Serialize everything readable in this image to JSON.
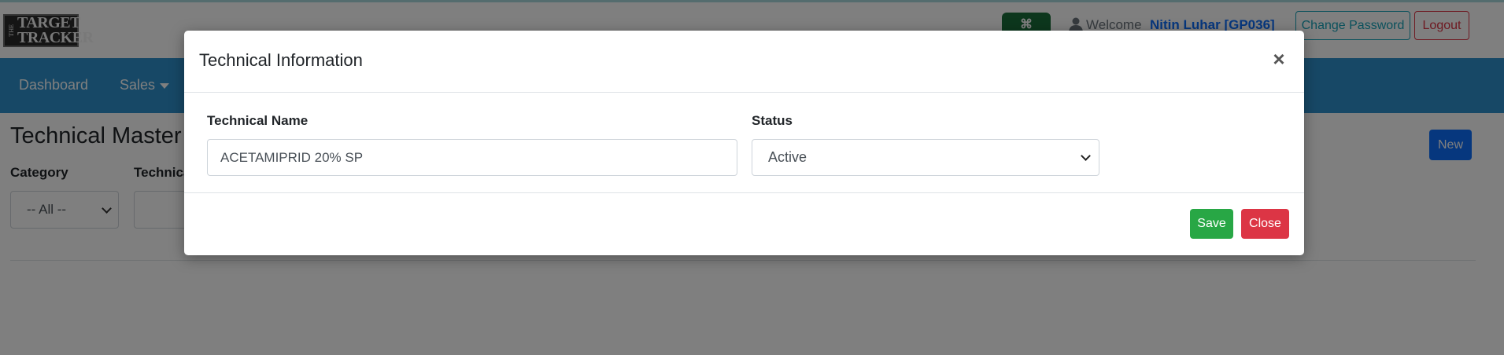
{
  "header": {
    "logo": {
      "the": "THE",
      "line1": "TARGET",
      "line2": "TRACKER"
    },
    "welcome": "Welcome",
    "username": "Nitin Luhar [GP036]",
    "change_password": "Change Password",
    "logout": "Logout"
  },
  "nav": {
    "items": [
      {
        "label": "Dashboard",
        "dropdown": false
      },
      {
        "label": "Sales",
        "dropdown": true
      }
    ],
    "color": "#2f91cc"
  },
  "page": {
    "title": "Technical Master",
    "new_button": "New",
    "filters": {
      "category_label": "Category",
      "category_value": "-- All --",
      "technical_label": "Technica"
    }
  },
  "modal": {
    "title": "Technical Information",
    "close_symbol": "×",
    "technical_name_label": "Technical Name",
    "technical_name_value": "ACETAMIPRID 20% SP",
    "status_label": "Status",
    "status_value": "Active",
    "save_label": "Save",
    "close_label": "Close"
  },
  "colors": {
    "primary": "#0d6efd",
    "success": "#28a745",
    "danger": "#dc3545",
    "info": "#17a2b8"
  }
}
